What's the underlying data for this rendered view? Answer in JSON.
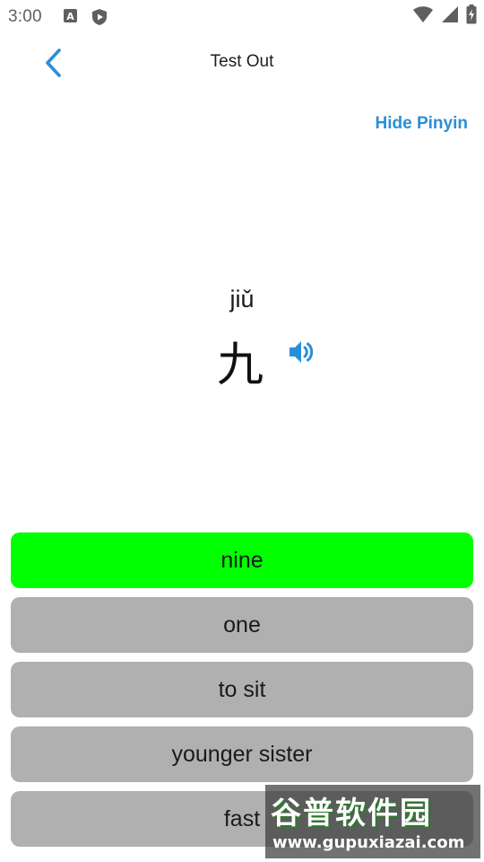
{
  "status_bar": {
    "time": "3:00",
    "left_icons": [
      "a-text-icon",
      "shield-play-icon"
    ],
    "right_icons": [
      "wifi-icon",
      "signal-icon",
      "battery-charging-icon"
    ]
  },
  "header": {
    "title": "Test Out",
    "back_icon": "chevron-left-icon"
  },
  "hide_pinyin_label": "Hide Pinyin",
  "card": {
    "pinyin": "jiǔ",
    "hanzi": "九",
    "speaker_icon": "speaker-icon"
  },
  "options": [
    {
      "label": "nine",
      "state": "correct"
    },
    {
      "label": "one",
      "state": "default"
    },
    {
      "label": "to sit",
      "state": "default"
    },
    {
      "label": "younger sister",
      "state": "default"
    },
    {
      "label": "fast",
      "state": "default"
    }
  ],
  "watermark": {
    "title": "谷普软件园",
    "url": "www.gupuxiazai.com"
  },
  "colors": {
    "accent": "#2a8fd9",
    "correct": "#00ff00",
    "option_default": "#b0b0b0"
  }
}
